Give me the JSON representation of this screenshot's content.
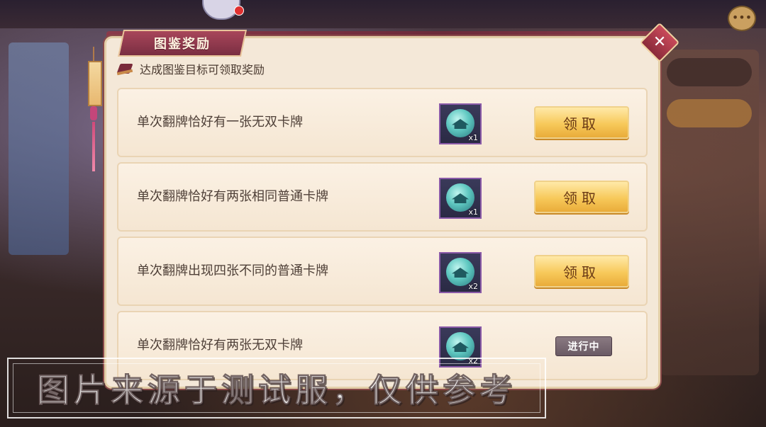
{
  "dialog": {
    "title": "图鉴奖励",
    "close_glyph": "✕",
    "subtitle": "达成图鉴目标可领取奖励"
  },
  "rewards": [
    {
      "description": "单次翻牌恰好有一张无双卡牌",
      "item_count": "x1",
      "action": "领取",
      "status": "claimable"
    },
    {
      "description": "单次翻牌恰好有两张相同普通卡牌",
      "item_count": "x1",
      "action": "领取",
      "status": "claimable"
    },
    {
      "description": "单次翻牌出现四张不同的普通卡牌",
      "item_count": "x2",
      "action": "领取",
      "status": "claimable"
    },
    {
      "description": "单次翻牌恰好有两张无双卡牌",
      "item_count": "x2",
      "action": "进行中",
      "status": "in_progress"
    }
  ],
  "watermark": "图片来源于测试服，仅供参考",
  "icons": {
    "chat": "chat-bubble-icon",
    "close": "close-icon",
    "subtitle": "tag-icon",
    "reward": "jade-orb-icon"
  },
  "colors": {
    "claim_button": "#f7c95a",
    "dialog_bg": "#f4e8d8",
    "title_banner": "#7a2e42",
    "in_progress_badge": "#7a6a74"
  }
}
